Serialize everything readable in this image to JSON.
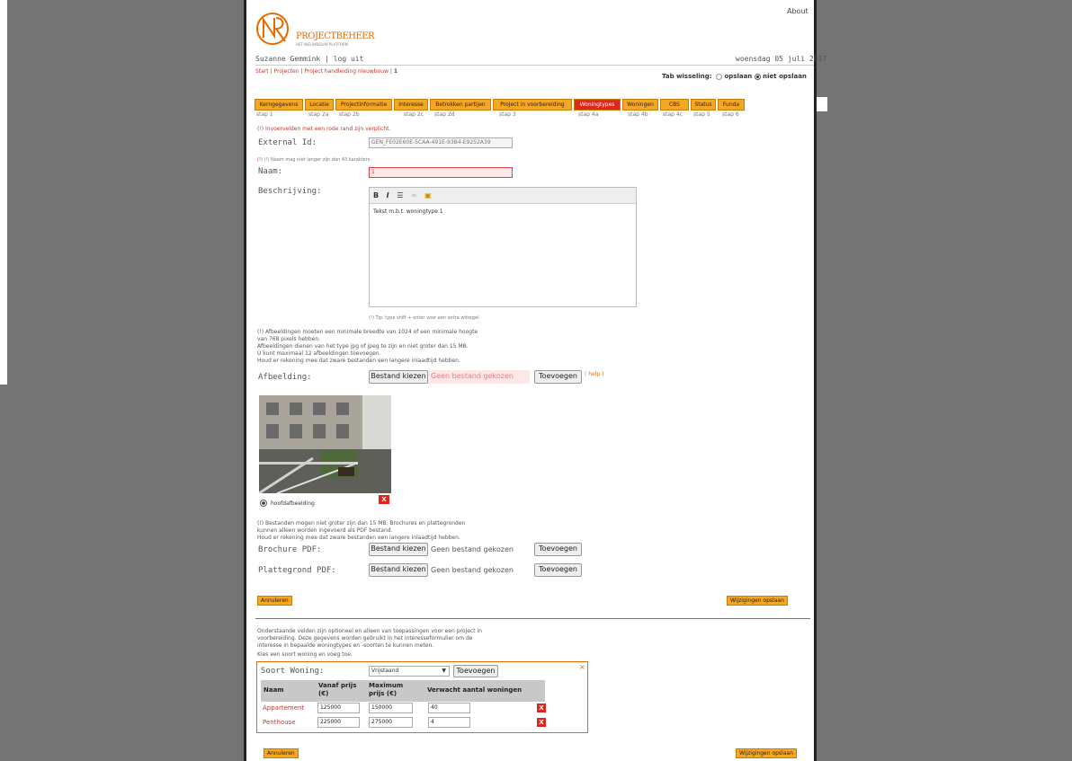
{
  "header": {
    "about": "About",
    "logo_text": "PROJECTBEHEER",
    "logo_sub": "HET NIEUWBOUW PLATFORM",
    "user": "Suzanne Gemmink | log uit",
    "date": "woensdag 05 juli 2017"
  },
  "breadcrumb": {
    "start": "Start",
    "projecten": "Projecten",
    "project": "Project handleiding nieuwbouw",
    "current": "1"
  },
  "tabswitch": {
    "label": "Tab wisseling:",
    "opt1": "opslaan",
    "opt2": "niet opslaan"
  },
  "tabs": [
    {
      "label": "Kerngegevens",
      "step": "stap 1"
    },
    {
      "label": "Locatie",
      "step": "stap 2a"
    },
    {
      "label": "Projectinformatie",
      "step": "stap 2b"
    },
    {
      "label": "Interesse",
      "step": "stap 2c"
    },
    {
      "label": "Betrokken partijen",
      "step": "stap 2d"
    },
    {
      "label": "Project in voorbereiding",
      "step": "stap 3"
    },
    {
      "label": "Woningtypes",
      "step": "stap 4a"
    },
    {
      "label": "Woningen",
      "step": "stap 4b"
    },
    {
      "label": "CBS",
      "step": "stap 4c"
    },
    {
      "label": "Status",
      "step": "stap 5"
    },
    {
      "label": "Funda",
      "step": "stap 6"
    }
  ],
  "form": {
    "required_note": "(!) Invoervelden met een rode rand zijn verplicht.",
    "external_id_label": "External Id:",
    "external_id_value": "GEN_FE02E60E-5CAA-491E-93B4-E9252A39",
    "name_note": "(!) Naam mag niet langer zijn dan 43 karakters.",
    "naam_label": "Naam:",
    "naam_value": "1",
    "beschrijving_label": "Beschrijving:",
    "editor_text": "Tekst m.b.t. woningtype 1",
    "tip": "(!) Tip: type shift + enter voor een extra witregel.",
    "image_note1": "(!) Afbeeldingen moeten een minimale breedte van 1024 of een minimale hoogte",
    "image_note2": "van 768 pixels hebben.",
    "image_note3": "Afbeeldingen dienen van het type jpg of jpeg te zijn en niet groter dan 15 MB.",
    "image_note4": "U kunt maximaal 12 afbeeldingen toevoegen.",
    "image_note5": "Houd er rekening mee dat zware bestanden een langere inlaadtijd hebben.",
    "afbeelding_label": "Afbeelding:",
    "choose_file": "Bestand kiezen",
    "no_file": "Geen bestand gekozen",
    "add": "Toevoegen",
    "help": "( help )",
    "hoofd": "hoofdafbeelding",
    "pdf_note1": "(!) Bestanden mogen niet groter zijn dan 15 MB. Brochures en plattegronden",
    "pdf_note2": "kunnen alleen worden ingevoerd als PDF bestand.",
    "pdf_note3": "Houd er rekening mee dat zware bestanden een langere inlaadtijd hebben.",
    "brochure_label": "Brochure PDF:",
    "plattegrond_label": "Plattegrond PDF:",
    "cancel": "Annuleren",
    "save": "Wijzigingen opslaan"
  },
  "optional": {
    "note1": "Onderstaande velden zijn optioneel en alleen van toepassingen voor een project in",
    "note2": "voorbereiding. Deze gegevens worden gebruikt in het interesseformulier om de",
    "note3": "interesse in bepaalde woningtypes en -soorten te kunnen meten.",
    "note4": "Kies een soort woning en voeg toe.",
    "soort_label": "Soort Woning:",
    "soort_value": "Vrijstaand",
    "add": "Toevoegen",
    "close": "×",
    "headers": [
      "Naam",
      "Vanaf prijs (€)",
      "Maximum prijs (€)",
      "Verwacht aantal woningen"
    ],
    "rows": [
      {
        "naam": "Appartement",
        "vanaf": "125000",
        "max": "150000",
        "aantal": "40"
      },
      {
        "naam": "Penthouse",
        "vanaf": "225000",
        "max": "275000",
        "aantal": "4"
      }
    ],
    "cancel": "Annuleren",
    "save": "Wijzigingen opslaan"
  }
}
